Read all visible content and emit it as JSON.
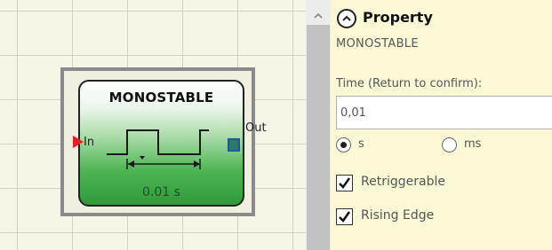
{
  "canvas": {
    "block": {
      "title": "MONOSTABLE",
      "value": "0.01 s",
      "input_pin": "In",
      "output_pin": "Out"
    }
  },
  "panel": {
    "title": "Property",
    "block_name": "MONOSTABLE",
    "time_label": "Time (Return to confirm):",
    "time_value": "0,01",
    "unit_options": [
      "s",
      "ms"
    ],
    "selected_unit": "s",
    "retriggerable_label": "Retriggerable",
    "retriggerable_checked": true,
    "rising_edge_label": "Rising Edge",
    "rising_edge_checked": true
  },
  "icons": {
    "collapse": "chevron-up-circle-icon",
    "scroll_up": "scroll-up-arrow-icon",
    "input_pin": "red-triangle-input-icon",
    "output_pin": "square-output-icon",
    "pulse": "monostable-pulse-icon"
  },
  "colors": {
    "block_green": "#2f9a3a",
    "panel_background": "#fbf8d6",
    "canvas_background": "#f7f6e6",
    "input_pin": "#e8202a",
    "output_pin": "#2d7a67"
  }
}
